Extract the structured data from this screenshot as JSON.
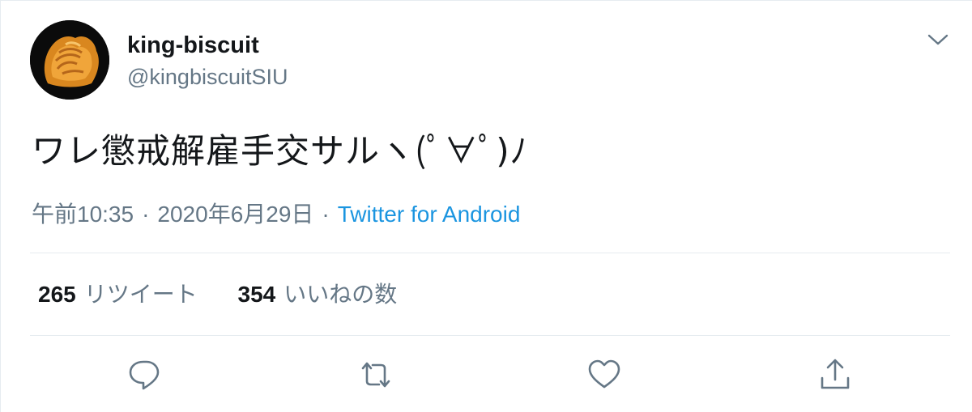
{
  "author": {
    "name": "king-biscuit",
    "handle": "@kingbiscuitSIU"
  },
  "tweet": {
    "text": "ワレ懲戒解雇手交サルヽ(ﾟ∀ﾟ)ﾉ",
    "time": "午前10:35",
    "date": "2020年6月29日",
    "separator": "·",
    "source": "Twitter for Android"
  },
  "stats": {
    "retweets": {
      "count": "265",
      "label": "リツイート"
    },
    "likes": {
      "count": "354",
      "label": "いいねの数"
    }
  },
  "actions": {
    "reply_icon": "speech-bubble",
    "retweet_icon": "retweet-arrows",
    "like_icon": "heart",
    "share_icon": "upload-arrow"
  },
  "colors": {
    "text": "#14171a",
    "secondary": "#657786",
    "link": "#1b95e0",
    "divider": "#e6ecf0"
  }
}
